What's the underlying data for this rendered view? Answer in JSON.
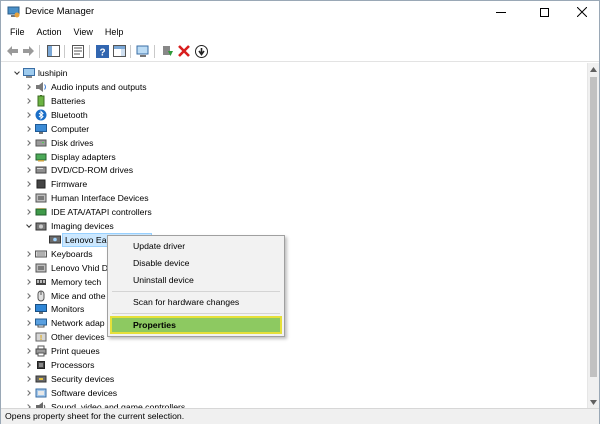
{
  "window": {
    "title": "Device Manager"
  },
  "menu": [
    "File",
    "Action",
    "View",
    "Help"
  ],
  "tree": {
    "root": "lushipin",
    "categories": [
      {
        "label": "Audio inputs and outputs",
        "icon": "speaker-icon"
      },
      {
        "label": "Batteries",
        "icon": "battery-icon"
      },
      {
        "label": "Bluetooth",
        "icon": "bluetooth-icon"
      },
      {
        "label": "Computer",
        "icon": "computer-icon"
      },
      {
        "label": "Disk drives",
        "icon": "disk-drive-icon"
      },
      {
        "label": "Display adapters",
        "icon": "display-adapter-icon"
      },
      {
        "label": "DVD/CD-ROM drives",
        "icon": "dvd-drive-icon"
      },
      {
        "label": "Firmware",
        "icon": "firmware-icon"
      },
      {
        "label": "Human Interface Devices",
        "icon": "hid-icon"
      },
      {
        "label": "IDE ATA/ATAPI controllers",
        "icon": "ide-controller-icon"
      },
      {
        "label": "Imaging devices",
        "icon": "camera-icon",
        "expanded": true
      },
      {
        "label": "Lenovo Ea",
        "icon": "webcam-icon",
        "child": true,
        "selected": true
      },
      {
        "label": "Keyboards",
        "icon": "keyboard-icon"
      },
      {
        "label": "Lenovo Vhid D",
        "icon": "hid-icon"
      },
      {
        "label": "Memory tech",
        "icon": "memory-icon"
      },
      {
        "label": "Mice and othe",
        "icon": "mouse-icon"
      },
      {
        "label": "Monitors",
        "icon": "monitor-icon"
      },
      {
        "label": "Network adap",
        "icon": "network-icon"
      },
      {
        "label": "Other devices",
        "icon": "unknown-device-icon"
      },
      {
        "label": "Print queues",
        "icon": "printer-icon"
      },
      {
        "label": "Processors",
        "icon": "processor-icon"
      },
      {
        "label": "Security devices",
        "icon": "security-device-icon"
      },
      {
        "label": "Software devices",
        "icon": "software-device-icon"
      },
      {
        "label": "Sound, video and game controllers",
        "icon": "sound-icon"
      }
    ]
  },
  "context_menu": {
    "items": [
      "Update driver",
      "Disable device",
      "Uninstall device",
      "Scan for hardware changes"
    ],
    "highlighted": "Properties",
    "highlight_color": "#8dc961",
    "highlight_border": "#e5e03a"
  },
  "status": {
    "text": "Opens property sheet for the current selection."
  }
}
